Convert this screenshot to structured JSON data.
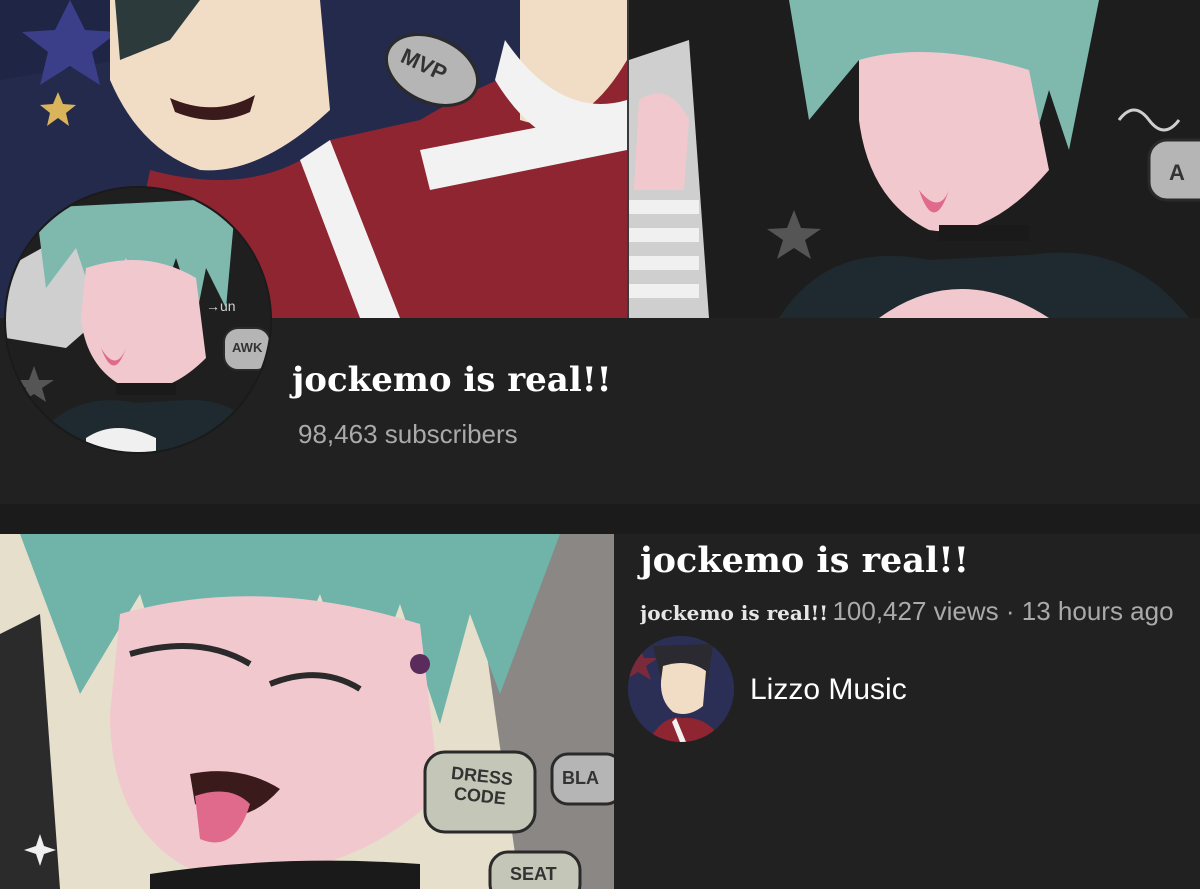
{
  "channel": {
    "name": "jockemo is real!!",
    "subscribers": "98,463 subscribers",
    "banner_bubbles": [
      "MVP",
      "A"
    ]
  },
  "avatar_art": {
    "bubble_text": "AWK",
    "scribble": "→un"
  },
  "video": {
    "title": "jockemo is real!!",
    "channel_name": "jockemo is real!!",
    "meta": "100,427 views · 13 hours ago",
    "owner": "Lizzo Music",
    "thumb_bubbles": [
      "DRESS CODE",
      "BLA",
      "SEAT"
    ]
  },
  "colors": {
    "background": "#212121",
    "jersey_red": "#8e2531",
    "hair_teal": "#6fb3a9",
    "secondary_text": "#aaaaaa"
  }
}
